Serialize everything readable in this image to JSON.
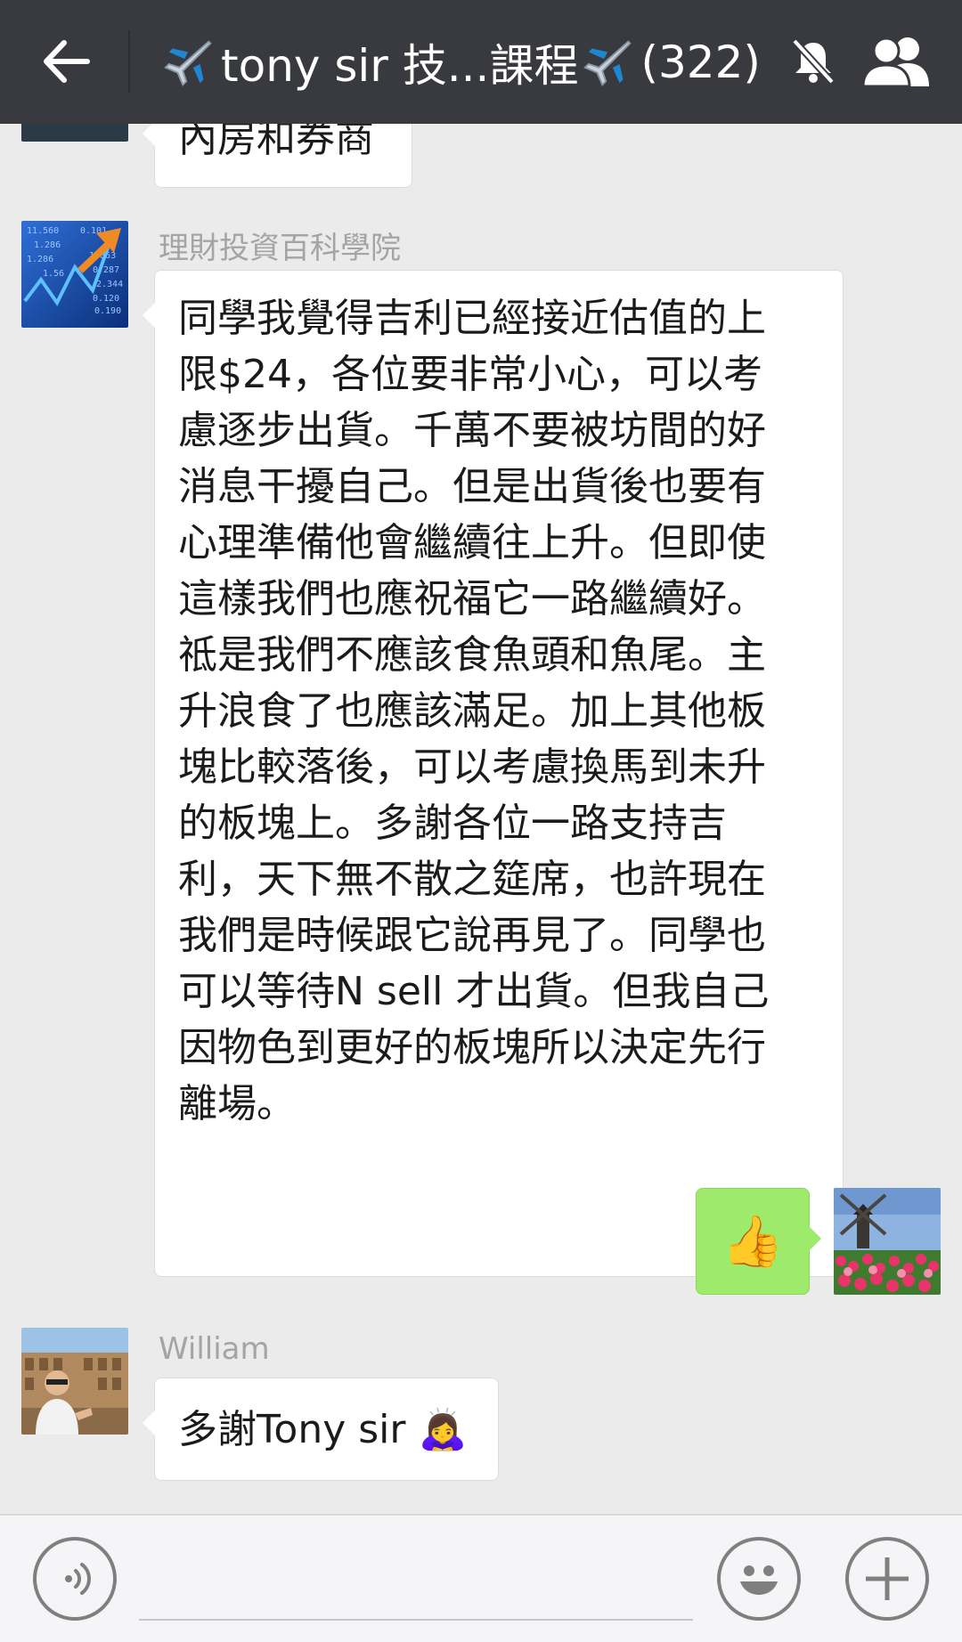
{
  "header": {
    "title_part1": "tony sir 技...課程",
    "title_part2": "(322)",
    "back_icon": "arrow-left-icon",
    "mute_icon": "bell-muted-icon",
    "members_icon": "group-members-icon"
  },
  "messages": [
    {
      "sender": "",
      "text": "內房和券商",
      "side": "left"
    },
    {
      "sender": "理財投資百科學院",
      "lines": [
        "同學我覺得吉利已經接近估值的上",
        "限$24，各位要非常小心，可以考",
        "慮逐步出貨。千萬不要被坊間的好",
        "消息干擾自己。但是出貨後也要有",
        "心理準備他會繼續往上升。但即使",
        "這樣我們也應祝福它一路繼續好。",
        "祗是我們不應該食魚頭和魚尾。主",
        "升浪食了也應該滿足。加上其他板",
        "塊比較落後，可以考慮換馬到未升",
        "的板塊上。多謝各位一路支持吉",
        "利，天下無不散之筵席，也許現在",
        "我們是時候跟它說再見了。同學也",
        "可以等待N sell 才出貨。但我自己",
        "因物色到更好的板塊所以決定先行",
        "離場。"
      ],
      "side": "left"
    },
    {
      "sender": "",
      "text": "👍",
      "side": "right"
    },
    {
      "sender": "William",
      "text": "多謝Tony sir 🙇‍♀️",
      "side": "left"
    }
  ],
  "input": {
    "value": "",
    "voice_icon": "voice-icon",
    "emoji_icon": "emoji-icon",
    "plus_icon": "plus-icon"
  },
  "colors": {
    "header_bg": "#393a3f",
    "chat_bg": "#ebebeb",
    "own_bubble": "#9eea6a",
    "other_bubble": "#ffffff"
  }
}
